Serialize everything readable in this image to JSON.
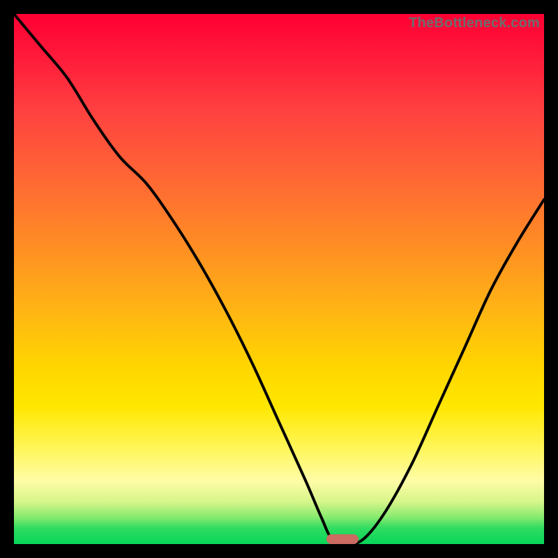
{
  "watermark": "TheBottleneck.com",
  "colors": {
    "curve": "#000000",
    "marker": "#cb6b61",
    "frame": "#000000"
  },
  "chart_data": {
    "type": "line",
    "title": "",
    "xlabel": "",
    "ylabel": "",
    "xlim": [
      0,
      100
    ],
    "ylim": [
      0,
      100
    ],
    "grid": false,
    "annotations": [
      {
        "text": "TheBottleneck.com",
        "position": "top-right"
      }
    ],
    "series": [
      {
        "name": "bottleneck-curve",
        "x": [
          0,
          5,
          10,
          15,
          20,
          25,
          30,
          35,
          40,
          45,
          50,
          55,
          58,
          60,
          63,
          66,
          70,
          75,
          80,
          85,
          90,
          95,
          100
        ],
        "y": [
          100,
          94,
          88,
          80,
          73,
          68,
          61,
          53,
          44,
          34,
          23,
          12,
          5,
          1,
          0,
          1,
          6,
          15,
          26,
          37,
          48,
          57,
          65
        ]
      }
    ],
    "marker": {
      "x": 62,
      "y": 0,
      "shape": "rounded-bar"
    },
    "background_gradient": [
      {
        "stop": 0.0,
        "color": "#ff0033"
      },
      {
        "stop": 0.45,
        "color": "#ff9122"
      },
      {
        "stop": 0.74,
        "color": "#ffe700"
      },
      {
        "stop": 0.92,
        "color": "#d7f58a"
      },
      {
        "stop": 1.0,
        "color": "#07d65a"
      }
    ]
  }
}
